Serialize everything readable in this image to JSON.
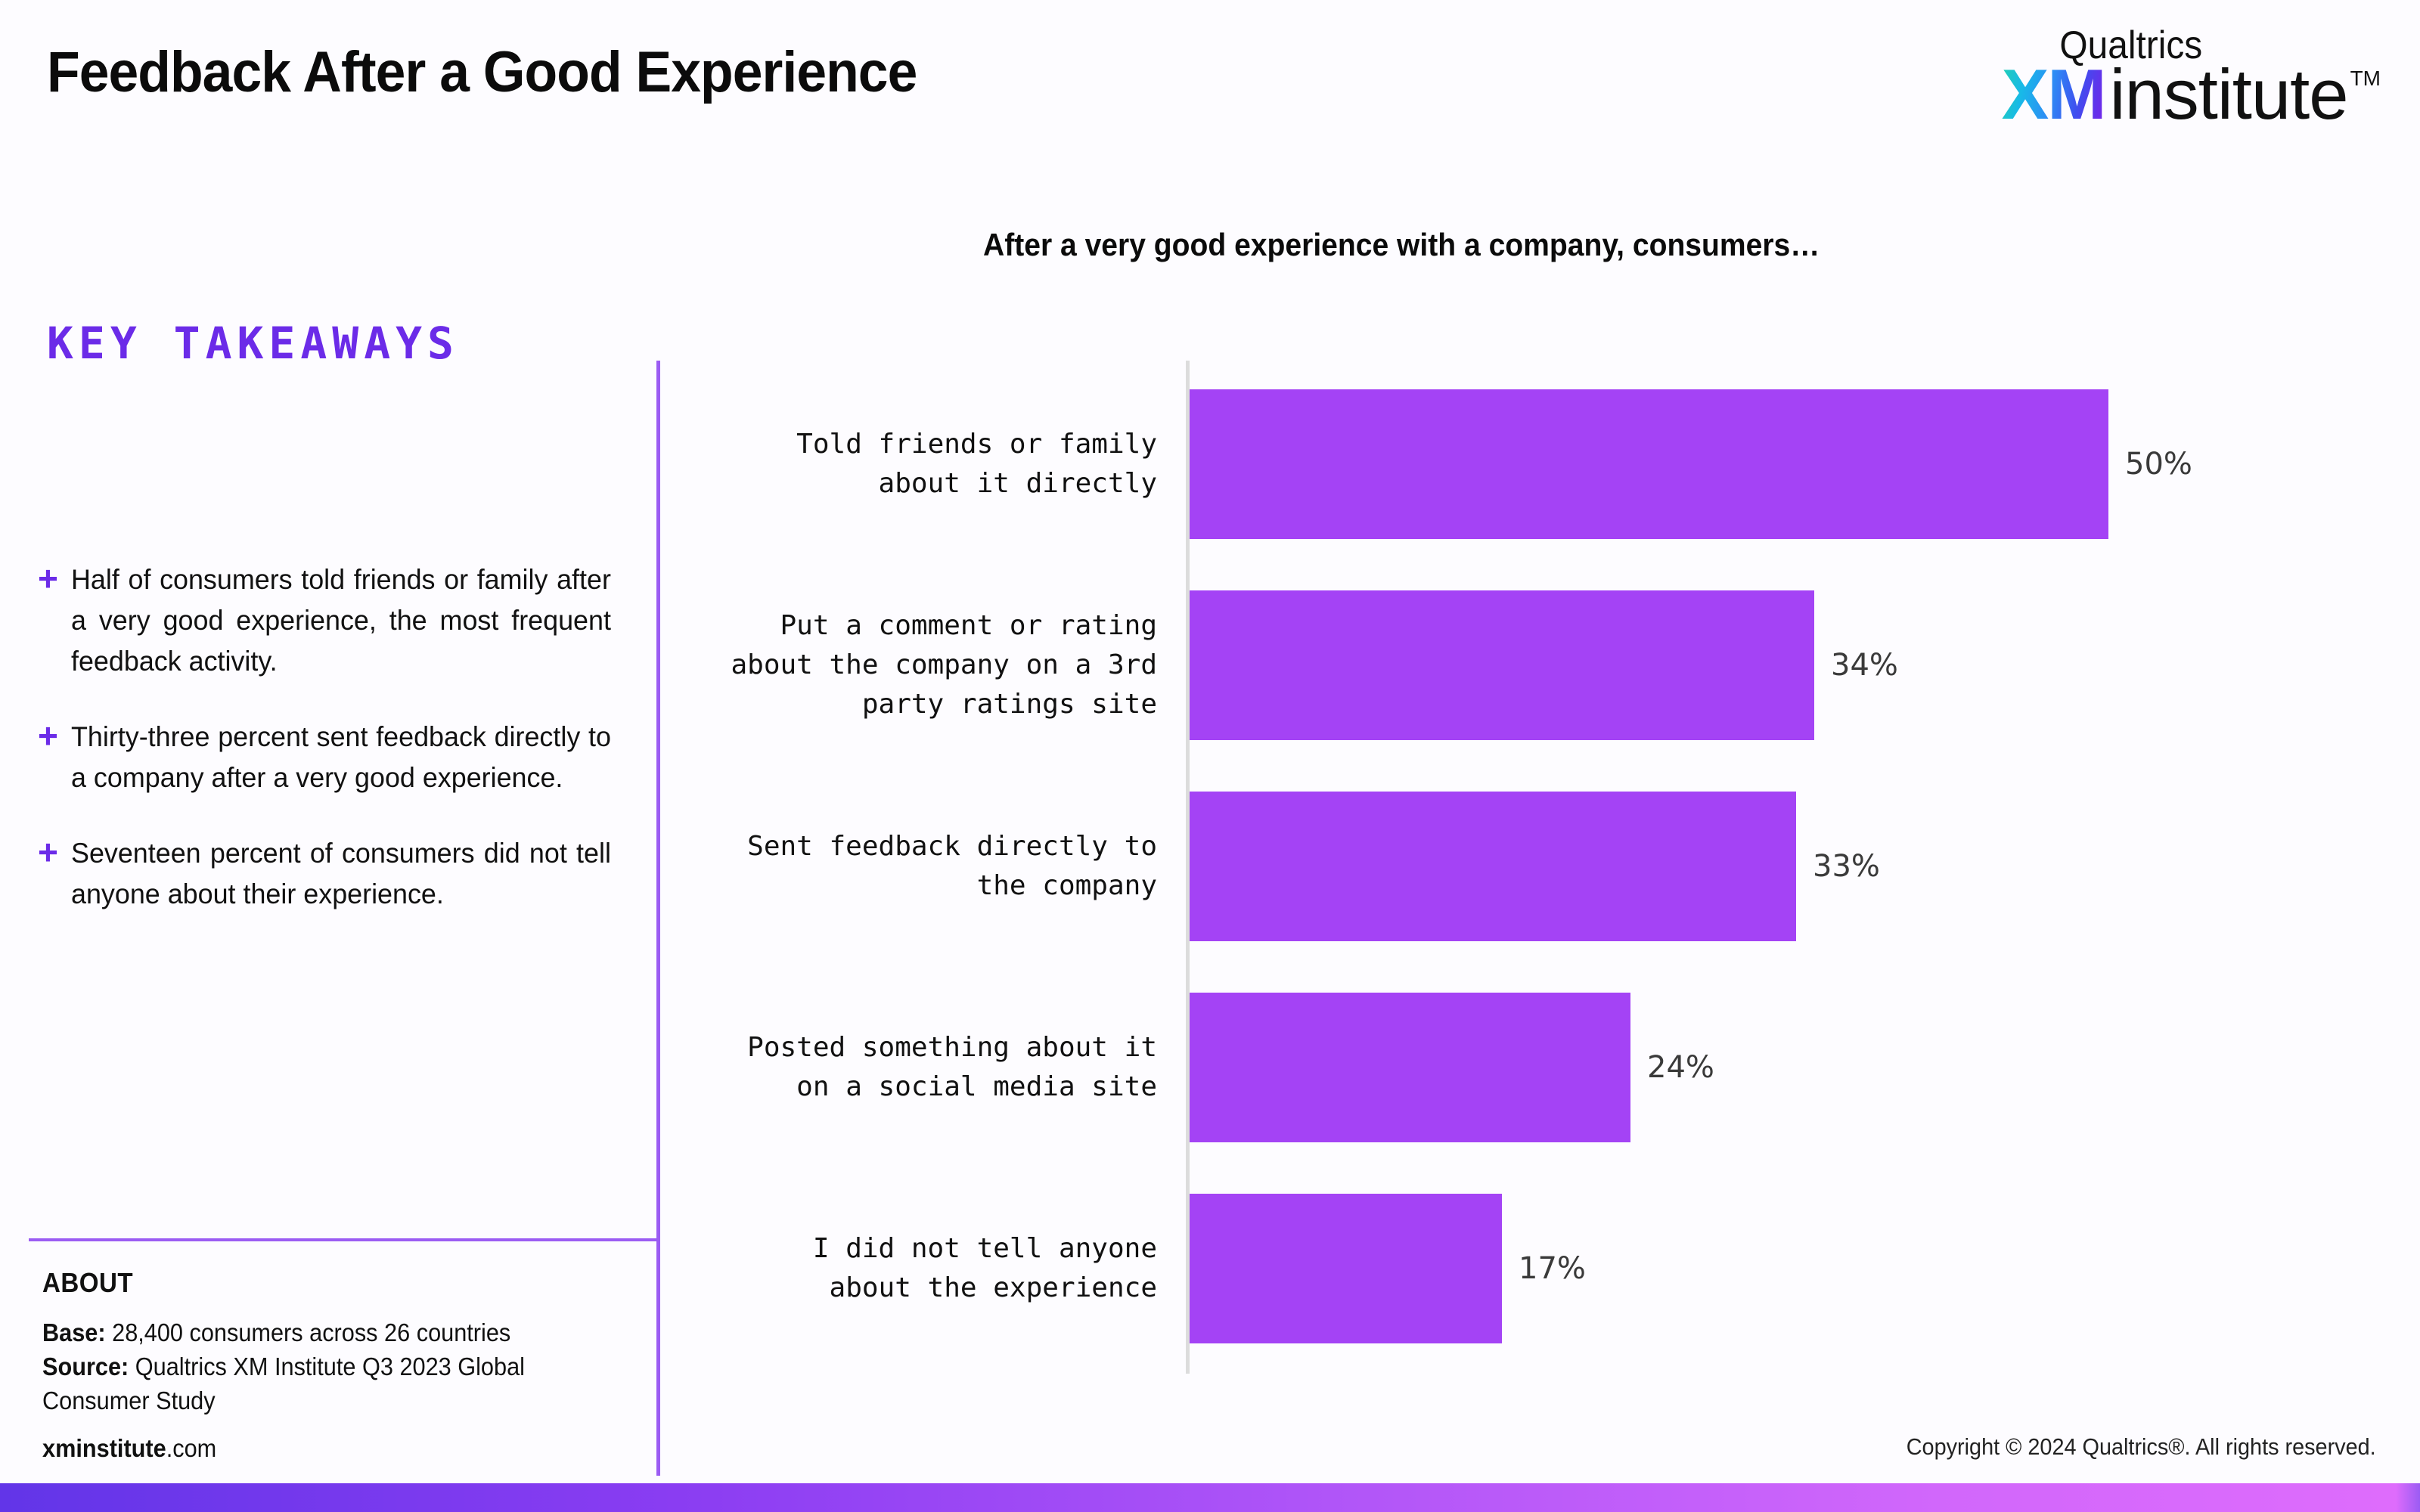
{
  "header": {
    "title": "Feedback After a Good Experience",
    "logo": {
      "brand": "Qualtrics",
      "xm": "XM",
      "institute": "institute",
      "tm": "TM"
    }
  },
  "left_panel": {
    "key_takeaways_title": "KEY TAKEAWAYS",
    "bullet_glyph": "+",
    "takeaways": [
      "Half of consumers told friends or family after a very good experience, the most frequent feedback activity.",
      "Thirty-three percent sent feedback directly to a company after a very good experience.",
      "Seventeen percent of consumers did not tell anyone about their experience."
    ],
    "about": {
      "heading": "ABOUT",
      "base_label": "Base:",
      "base_value": " 28,400 consumers across 26 countries",
      "source_label": "Source:",
      "source_value": " Qualtrics XM Institute Q3 2023 Global Consumer Study",
      "url_bold": "xminstitute",
      "url_rest": ".com"
    }
  },
  "chart_data": {
    "type": "bar",
    "orientation": "horizontal",
    "title": "After a very good experience with a company, consumers…",
    "xlabel": "",
    "ylabel": "",
    "xlim": [
      0,
      55
    ],
    "grid": false,
    "legend": "none",
    "bar_color": "#A443F5",
    "axis_color": "#dcdcdc",
    "value_suffix": "%",
    "categories": [
      "Told friends or family\nabout it directly",
      "Put a comment or rating\nabout the company on a 3rd\nparty ratings site",
      "Sent feedback directly to\nthe company",
      "Posted something about it\non a social media site",
      "I did not tell anyone\nabout the experience"
    ],
    "values": [
      50,
      34,
      33,
      24,
      17
    ],
    "value_labels": [
      "50%",
      "34%",
      "33%",
      "24%",
      "17%"
    ]
  },
  "footer": {
    "copyright": "Copyright © 2024 Qualtrics®. All rights reserved."
  },
  "colors": {
    "accent_purple": "#6B2BE8",
    "divider_purple": "#9B5CF3",
    "bar_purple": "#A443F5",
    "gradient_start": "#6235E8",
    "gradient_end": "#DE6CFC"
  }
}
